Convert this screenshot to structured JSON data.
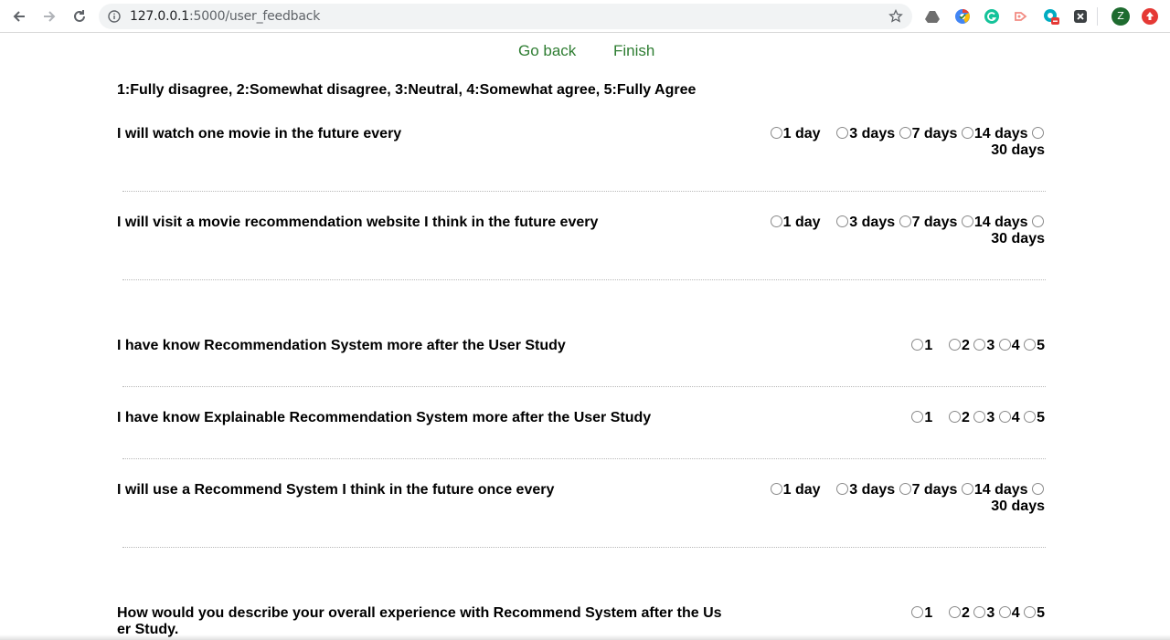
{
  "browser": {
    "url_host": "127.0.0.1",
    "url_rest": ":5000/user_feedback",
    "profile_initial": "Z",
    "icons": [
      "back-arrow-icon",
      "forward-arrow-icon",
      "reload-icon",
      "info-icon",
      "star-icon",
      "drive-icon",
      "chrome-extension-icon",
      "grammarly-icon",
      "share-icon",
      "c-extension-icon",
      "x-extension-icon",
      "profile-avatar",
      "update-icon"
    ]
  },
  "nav": {
    "go_back": "Go back",
    "finish": "Finish"
  },
  "legend": "1:Fully disagree, 2:Somewhat disagree, 3:Neutral, 4:Somewhat agree, 5:Fully Agree",
  "questions": [
    {
      "text": "I will watch one movie in the future every",
      "options": [
        "1 day",
        "3 days",
        "7 days",
        "14 days",
        "30 days"
      ]
    },
    {
      "text": "I will visit a movie recommendation website I think in the future every",
      "options": [
        "1 day",
        "3 days",
        "7 days",
        "14 days",
        "30 days"
      ]
    },
    {
      "text": "I have know Recommendation System more after the User Study",
      "options": [
        "1",
        "2",
        "3",
        "4",
        "5"
      ]
    },
    {
      "text": "I have know Explainable Recommendation System more after the User Study",
      "options": [
        "1",
        "2",
        "3",
        "4",
        "5"
      ]
    },
    {
      "text": "I will use a Recommend System I think in the future once every",
      "options": [
        "1 day",
        "3 days",
        "7 days",
        "14 days",
        "30 days"
      ]
    },
    {
      "text": "How would you describe your overall experience with Recommend System after the User Study.",
      "options": [
        "1",
        "2",
        "3",
        "4",
        "5"
      ]
    }
  ]
}
